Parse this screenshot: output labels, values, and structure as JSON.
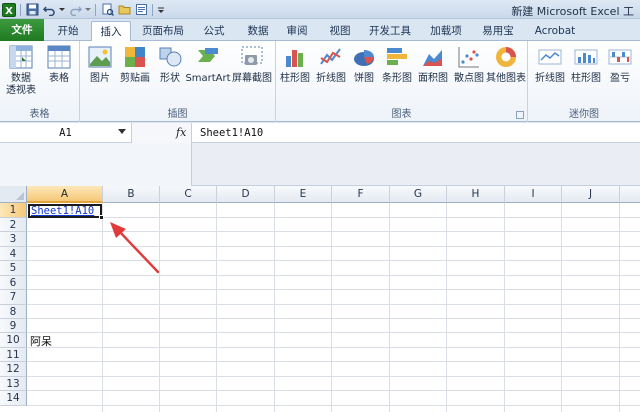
{
  "window": {
    "title": "新建 Microsoft Excel 工"
  },
  "tabs": [
    {
      "label": "文件"
    },
    {
      "label": "开始"
    },
    {
      "label": "插入"
    },
    {
      "label": "页面布局"
    },
    {
      "label": "公式"
    },
    {
      "label": "数据"
    },
    {
      "label": "审阅"
    },
    {
      "label": "视图"
    },
    {
      "label": "开发工具"
    },
    {
      "label": "加载项"
    },
    {
      "label": "易用宝"
    },
    {
      "label": "Acrobat"
    }
  ],
  "ribbon": {
    "groups": {
      "tables": "表格",
      "illustrations": "插图",
      "charts": "图表",
      "sparklines": "迷你图"
    },
    "buttons": {
      "pivot_line1": "数据",
      "pivot_line2": "透视表",
      "table": "表格",
      "picture": "图片",
      "clipart": "剪贴画",
      "shapes": "形状",
      "smartart": "SmartArt",
      "screenshot": "屏幕截图",
      "column": "柱形图",
      "line": "折线图",
      "pie": "饼图",
      "bar": "条形图",
      "area": "面积图",
      "scatter": "散点图",
      "other": "其他图表",
      "spark_line": "折线图",
      "spark_column": "柱形图",
      "spark_winloss": "盈亏"
    }
  },
  "formula_bar": {
    "name_box": "A1",
    "fx": "fx",
    "formula": "Sheet1!A10"
  },
  "sheet": {
    "columns": [
      "A",
      "B",
      "C",
      "D",
      "E",
      "F",
      "G",
      "H",
      "I",
      "J"
    ],
    "rows": [
      "1",
      "2",
      "3",
      "4",
      "5",
      "6",
      "7",
      "8",
      "9",
      "10",
      "11",
      "12",
      "13",
      "14"
    ],
    "cells": {
      "A1": "Sheet1!A10",
      "A10": "阿呆"
    }
  },
  "colors": {
    "file_tab": "#2a8a2d",
    "selection_header": "#f6c879",
    "hyperlink": "#1434c8",
    "annotation_arrow": "#e03a3a"
  }
}
